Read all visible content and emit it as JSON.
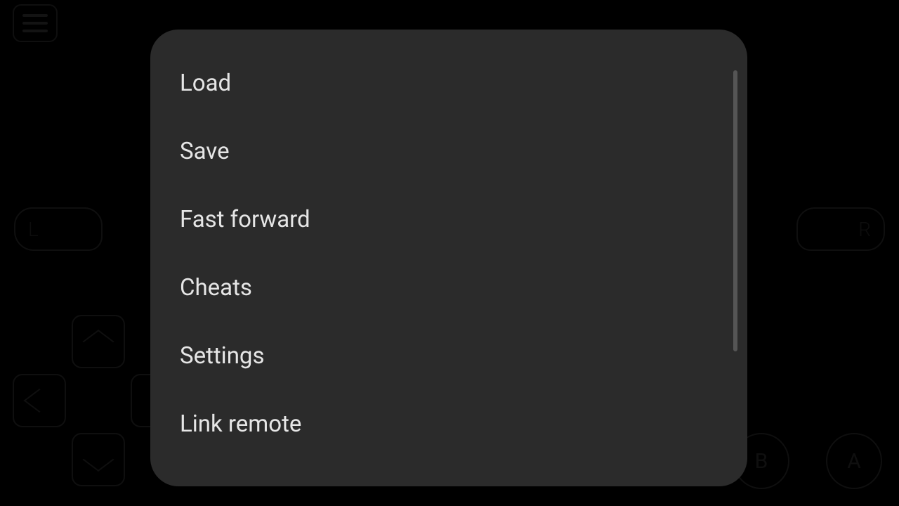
{
  "controls": {
    "shoulder_left": "L",
    "shoulder_right": "R",
    "face_a": "A",
    "face_b": "B"
  },
  "menu": {
    "items": [
      {
        "label": "Load"
      },
      {
        "label": "Save"
      },
      {
        "label": "Fast forward"
      },
      {
        "label": "Cheats"
      },
      {
        "label": "Settings"
      },
      {
        "label": "Link remote"
      }
    ]
  }
}
